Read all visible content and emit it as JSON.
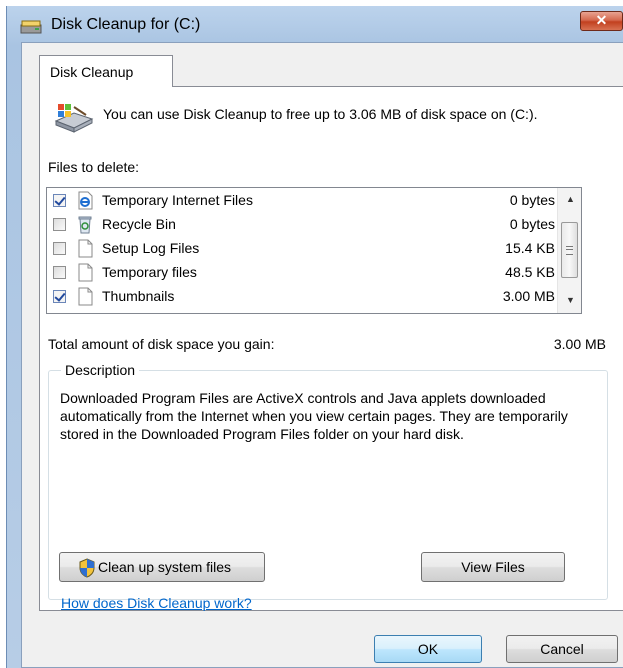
{
  "window": {
    "title": "Disk Cleanup for  (C:)",
    "close_label": "✕",
    "title_icon": "disk-cleanup-icon"
  },
  "tabs": [
    {
      "label": "Disk Cleanup",
      "selected": true
    }
  ],
  "info": {
    "text": "You can use Disk Cleanup to free up to 3.06 MB of disk space on  (C:).",
    "icon": "drive-cleanup-icon"
  },
  "files_label": "Files to delete:",
  "files": [
    {
      "name": "Temporary Internet Files",
      "size": "0 bytes",
      "checked": true,
      "icon": "ie-file-icon"
    },
    {
      "name": "Recycle Bin",
      "size": "0 bytes",
      "checked": false,
      "icon": "recycle-bin-icon"
    },
    {
      "name": "Setup Log Files",
      "size": "15.4 KB",
      "checked": false,
      "icon": "document-icon"
    },
    {
      "name": "Temporary files",
      "size": "48.5 KB",
      "checked": false,
      "icon": "document-icon"
    },
    {
      "name": "Thumbnails",
      "size": "3.00 MB",
      "checked": true,
      "icon": "document-icon"
    }
  ],
  "total": {
    "label": "Total amount of disk space you gain:",
    "value": "3.00 MB"
  },
  "description": {
    "legend": "Description",
    "text": "Downloaded Program Files are ActiveX controls and Java applets downloaded automatically from the Internet when you view certain pages. They are temporarily stored in the Downloaded Program Files folder on your hard disk."
  },
  "buttons": {
    "clean_system": "Clean up system files",
    "view_files": "View Files",
    "ok": "OK",
    "cancel": "Cancel"
  },
  "help_link": "How does Disk Cleanup work?",
  "colors": {
    "title_bar": "#b4cce8",
    "link": "#0066cc",
    "close_button": "#c2401f"
  }
}
